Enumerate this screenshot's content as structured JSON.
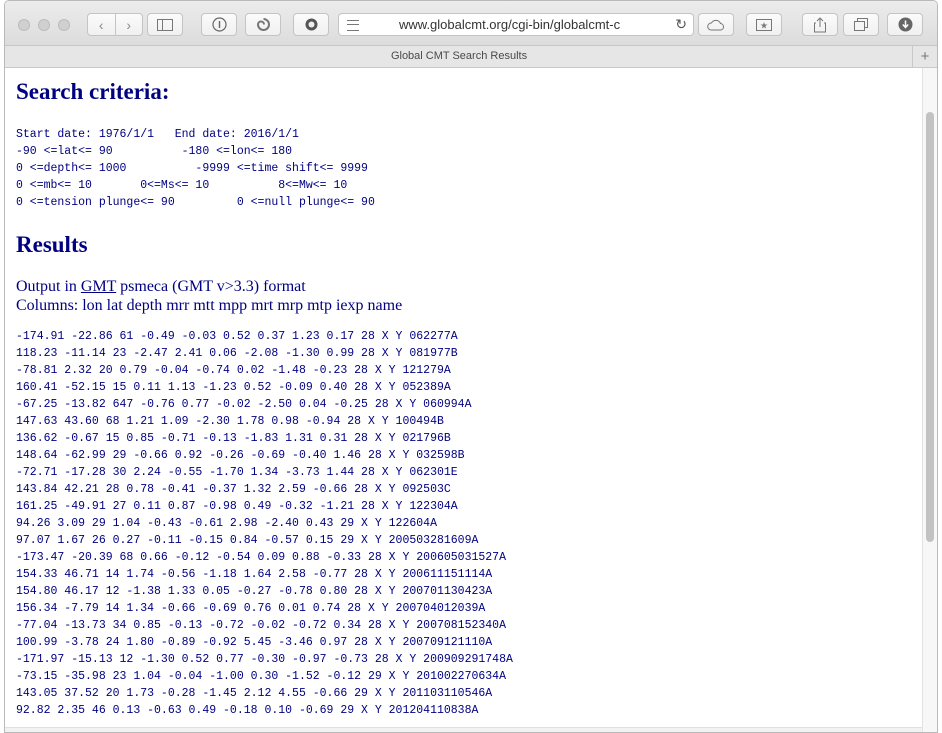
{
  "browser": {
    "url": "www.globalcmt.org/cgi-bin/globalcmt-c",
    "tab_title": "Global CMT Search Results",
    "back_icon": "‹",
    "forward_icon": "›",
    "new_tab_icon": "+"
  },
  "page": {
    "search_heading": "Search criteria:",
    "criteria_lines": [
      "Start date: 1976/1/1   End date: 2016/1/1",
      "-90 <=lat<= 90          -180 <=lon<= 180",
      "0 <=depth<= 1000          -9999 <=time shift<= 9999",
      "0 <=mb<= 10       0<=Ms<= 10          8<=Mw<= 10",
      "0 <=tension plunge<= 90         0 <=null plunge<= 90"
    ],
    "results_heading": "Results",
    "output_prefix": "Output in ",
    "output_link": "GMT",
    "output_suffix": " psmeca (GMT v>3.3) format",
    "columns_line": "Columns: lon lat depth mrr mtt mpp mrt mrp mtp iexp name",
    "rows": [
      "-174.91 -22.86 61 -0.49 -0.03 0.52 0.37 1.23 0.17 28 X Y 062277A",
      "118.23 -11.14 23 -2.47 2.41 0.06 -2.08 -1.30 0.99 28 X Y 081977B",
      "-78.81 2.32 20 0.79 -0.04 -0.74 0.02 -1.48 -0.23 28 X Y 121279A",
      "160.41 -52.15 15 0.11 1.13 -1.23 0.52 -0.09 0.40 28 X Y 052389A",
      "-67.25 -13.82 647 -0.76 0.77 -0.02 -2.50 0.04 -0.25 28 X Y 060994A",
      "147.63 43.60 68 1.21 1.09 -2.30 1.78 0.98 -0.94 28 X Y 100494B",
      "136.62 -0.67 15 0.85 -0.71 -0.13 -1.83 1.31 0.31 28 X Y 021796B",
      "148.64 -62.99 29 -0.66 0.92 -0.26 -0.69 -0.40 1.46 28 X Y 032598B",
      "-72.71 -17.28 30 2.24 -0.55 -1.70 1.34 -3.73 1.44 28 X Y 062301E",
      "143.84 42.21 28 0.78 -0.41 -0.37 1.32 2.59 -0.66 28 X Y 092503C",
      "161.25 -49.91 27 0.11 0.87 -0.98 0.49 -0.32 -1.21 28 X Y 122304A",
      "94.26 3.09 29 1.04 -0.43 -0.61 2.98 -2.40 0.43 29 X Y 122604A",
      "97.07 1.67 26 0.27 -0.11 -0.15 0.84 -0.57 0.15 29 X Y 200503281609A",
      "-173.47 -20.39 68 0.66 -0.12 -0.54 0.09 0.88 -0.33 28 X Y 200605031527A",
      "154.33 46.71 14 1.74 -0.56 -1.18 1.64 2.58 -0.77 28 X Y 200611151114A",
      "154.80 46.17 12 -1.38 1.33 0.05 -0.27 -0.78 0.80 28 X Y 200701130423A",
      "156.34 -7.79 14 1.34 -0.66 -0.69 0.76 0.01 0.74 28 X Y 200704012039A",
      "-77.04 -13.73 34 0.85 -0.13 -0.72 -0.02 -0.72 0.34 28 X Y 200708152340A",
      "100.99 -3.78 24 1.80 -0.89 -0.92 5.45 -3.46 0.97 28 X Y 200709121110A",
      "-171.97 -15.13 12 -1.30 0.52 0.77 -0.30 -0.97 -0.73 28 X Y 200909291748A",
      "-73.15 -35.98 23 1.04 -0.04 -1.00 0.30 -1.52 -0.12 29 X Y 201002270634A",
      "143.05 37.52 20 1.73 -0.28 -1.45 2.12 4.55 -0.66 29 X Y 201103110546A",
      "92.82 2.35 46 0.13 -0.63 0.49 -0.18 0.10 -0.69 29 X Y 201204110838A"
    ]
  }
}
